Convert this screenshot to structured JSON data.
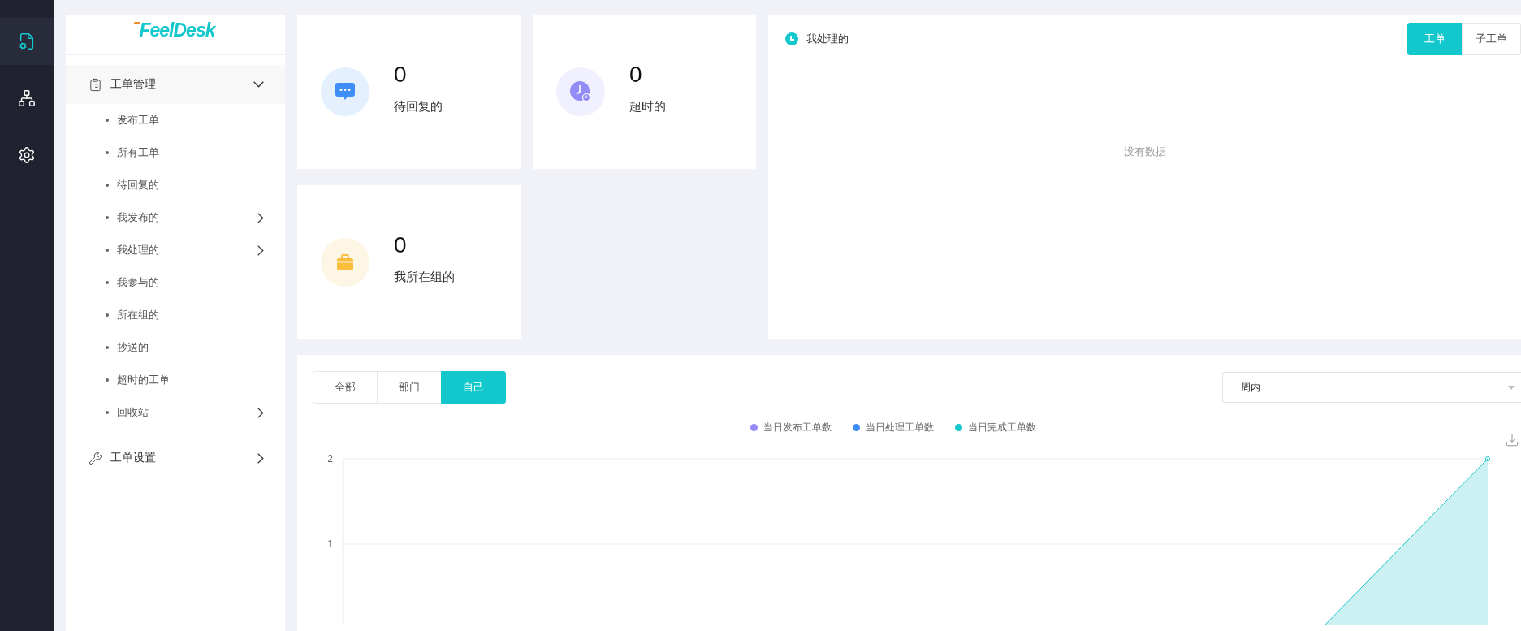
{
  "rail": {
    "items": [
      {
        "selected": true
      },
      {
        "selected": false
      },
      {
        "selected": false
      }
    ]
  },
  "logo": {
    "text": "FeelDesk"
  },
  "menu": [
    {
      "label": "工单管理",
      "expanded": true,
      "children": [
        {
          "label": "发布工单",
          "has_submenu": false
        },
        {
          "label": "所有工单",
          "has_submenu": false
        },
        {
          "label": "待回复的",
          "has_submenu": false
        },
        {
          "label": "我发布的",
          "has_submenu": true
        },
        {
          "label": "我处理的",
          "has_submenu": true
        },
        {
          "label": "我参与的",
          "has_submenu": false
        },
        {
          "label": "所在组的",
          "has_submenu": false
        },
        {
          "label": "抄送的",
          "has_submenu": false
        },
        {
          "label": "超时的工单",
          "has_submenu": false
        },
        {
          "label": "回收站",
          "has_submenu": true
        }
      ]
    },
    {
      "label": "工单设置",
      "expanded": false
    }
  ],
  "stats": [
    {
      "value": "0",
      "label": "待回复的",
      "color": "#3f8ef7"
    },
    {
      "value": "0",
      "label": "超时的",
      "color": "#938cf6"
    },
    {
      "value": "0",
      "label": "我所在组的",
      "color": "#fbbd3c"
    }
  ],
  "my_handled": {
    "title": "我处理的",
    "tabs": [
      {
        "label": "工单",
        "selected": true
      },
      {
        "label": "子工单",
        "selected": false
      }
    ],
    "empty": "没有数据"
  },
  "trend": {
    "scope_tabs": [
      {
        "label": "全部",
        "selected": false
      },
      {
        "label": "部门",
        "selected": false
      },
      {
        "label": "自己",
        "selected": true
      }
    ],
    "period": {
      "value": "一周内"
    },
    "legend": [
      {
        "name": "当日发布工单数",
        "color": "#938cf6"
      },
      {
        "name": "当日处理工单数",
        "color": "#3f8ef7"
      },
      {
        "name": "当日完成工单数",
        "color": "#13c7cc"
      }
    ],
    "y_axis_labels": [
      "2",
      "1"
    ]
  }
}
